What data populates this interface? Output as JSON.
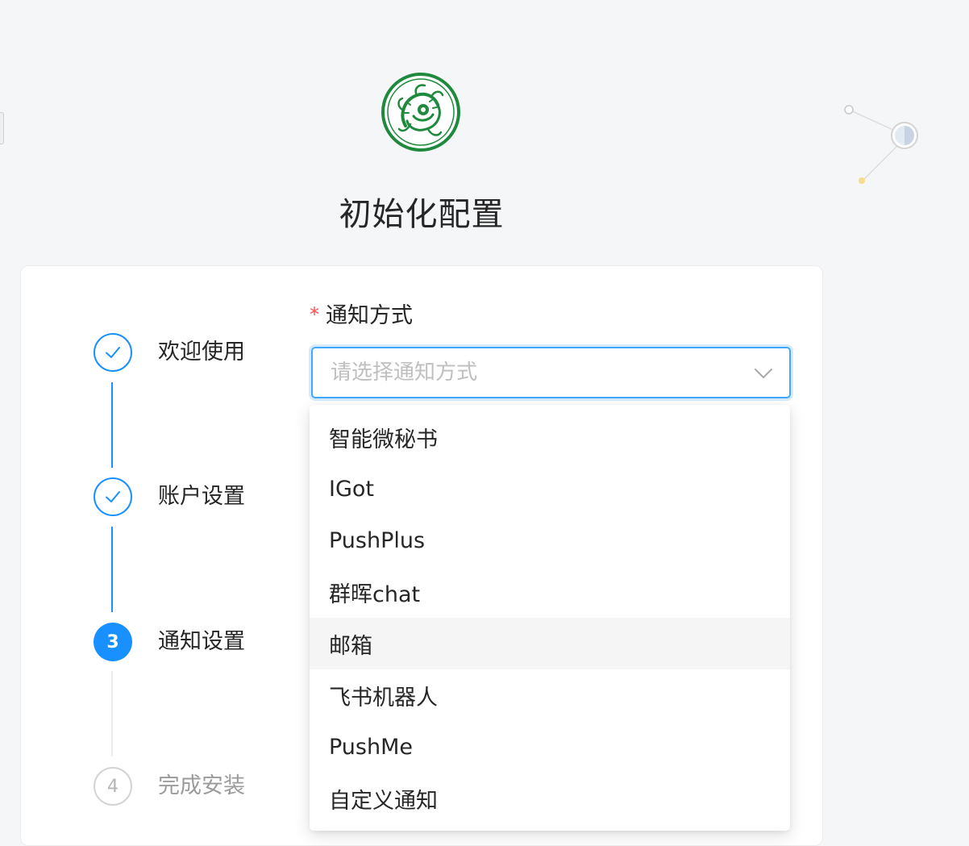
{
  "page": {
    "title": "初始化配置"
  },
  "steps": [
    {
      "label": "欢迎使用",
      "status": "finish",
      "icon": "check-icon"
    },
    {
      "label": "账户设置",
      "status": "finish",
      "icon": "check-icon"
    },
    {
      "label": "通知设置",
      "status": "process",
      "number": "3"
    },
    {
      "label": "完成安装",
      "status": "wait",
      "number": "4"
    }
  ],
  "form": {
    "required_mark": "*",
    "label": "通知方式",
    "placeholder": "请选择通知方式"
  },
  "dropdown": {
    "options": [
      "智能微秘书",
      "IGot",
      "PushPlus",
      "群晖chat",
      "邮箱",
      "飞书机器人",
      "PushMe",
      "自定义通知"
    ],
    "highlighted_index": 4
  },
  "colors": {
    "primary": "#1890ff",
    "required": "#ff4d4f",
    "logo_green": "#1f8a3e",
    "background": "#f5f6f8"
  }
}
